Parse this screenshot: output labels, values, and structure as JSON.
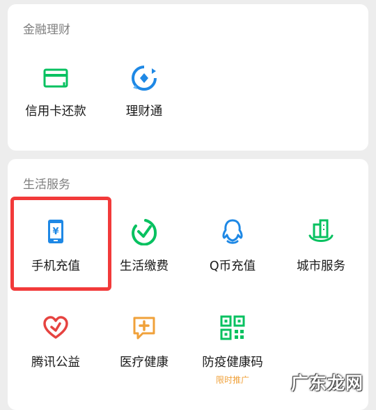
{
  "finance": {
    "title": "金融理财",
    "items": [
      {
        "label": "信用卡还款",
        "icon": "credit-card-icon"
      },
      {
        "label": "理财通",
        "icon": "wealth-icon"
      }
    ]
  },
  "life": {
    "title": "生活服务",
    "items": [
      {
        "label": "手机充值",
        "icon": "phone-topup-icon"
      },
      {
        "label": "生活缴费",
        "icon": "utility-payment-icon"
      },
      {
        "label": "Q币充值",
        "icon": "qq-coin-icon"
      },
      {
        "label": "城市服务",
        "icon": "city-service-icon"
      },
      {
        "label": "腾讯公益",
        "icon": "charity-icon"
      },
      {
        "label": "医疗健康",
        "icon": "medical-icon"
      },
      {
        "label": "防疫健康码",
        "icon": "qr-code-icon",
        "tag": "限时推广"
      }
    ]
  },
  "watermark": "广东龙网",
  "colors": {
    "green": "#07c160",
    "blue": "#1e88e5",
    "red": "#e64340",
    "orange": "#f0a13a",
    "highlight": "#f23a3a"
  }
}
